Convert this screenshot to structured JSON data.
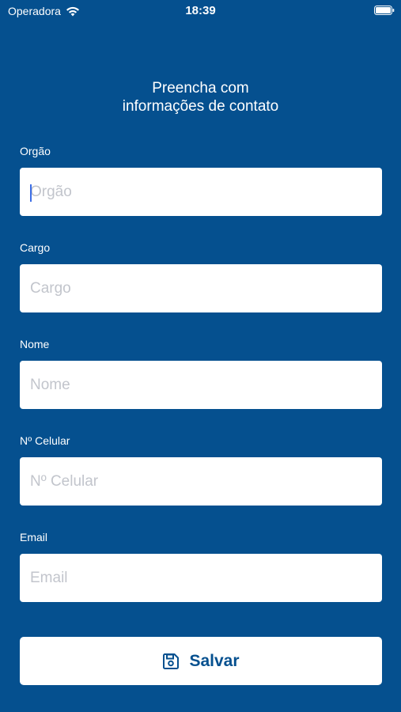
{
  "status_bar": {
    "carrier": "Operadora",
    "time": "18:39",
    "wifi_icon": "wifi-icon",
    "battery_icon": "battery-icon"
  },
  "header": {
    "title_line1": "Preencha com",
    "title_line2": "informações de contato"
  },
  "form": {
    "fields": [
      {
        "label": "Orgão",
        "placeholder": "Orgão",
        "value": ""
      },
      {
        "label": "Cargo",
        "placeholder": "Cargo",
        "value": ""
      },
      {
        "label": "Nome",
        "placeholder": "Nome",
        "value": ""
      },
      {
        "label": "Nº Celular",
        "placeholder": "Nº Celular",
        "value": ""
      },
      {
        "label": "Email",
        "placeholder": "Email",
        "value": ""
      }
    ],
    "focused_field": "Orgão"
  },
  "save_button": {
    "label": "Salvar",
    "icon": "save-icon"
  },
  "colors": {
    "background": "#05508f",
    "button_text": "#05508f",
    "input_background": "#ffffff",
    "placeholder": "#c2c5cc",
    "cursor": "#3c6ee6"
  }
}
